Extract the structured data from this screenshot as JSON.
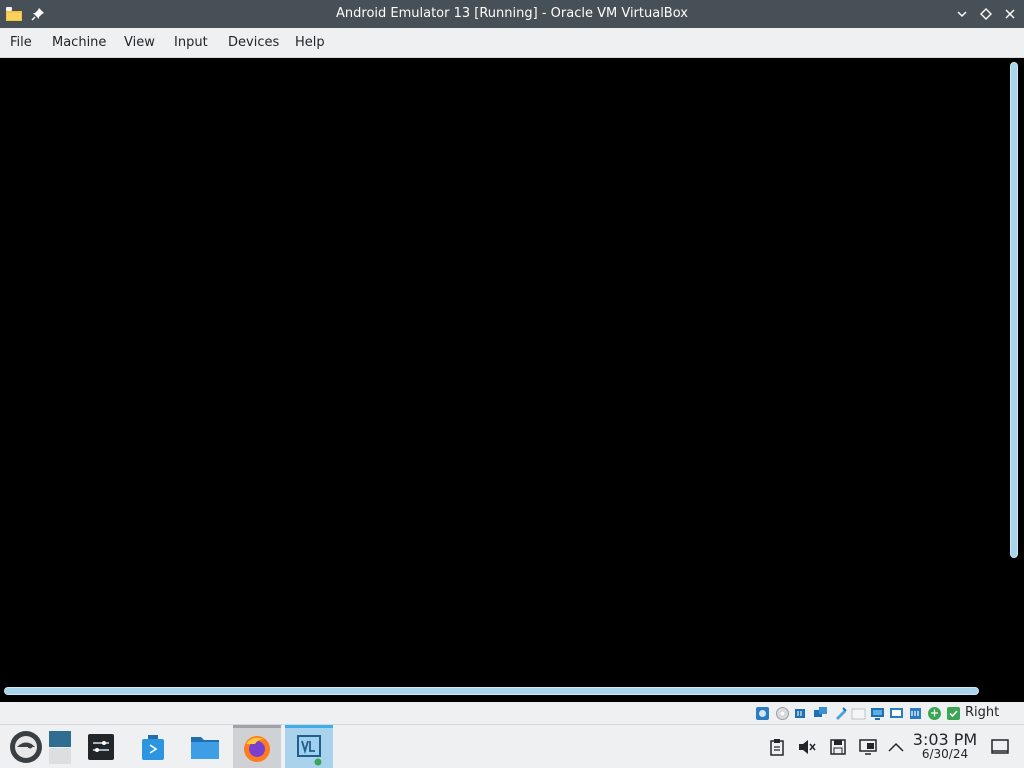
{
  "window": {
    "title": "Android Emulator 13 [Running] - Oracle VM VirtualBox",
    "app_icon": "virtualbox-folder-icon",
    "controls": [
      "minimize-icon",
      "maximize-icon",
      "close-icon"
    ]
  },
  "menubar": {
    "items": [
      "File",
      "Machine",
      "View",
      "Input",
      "Devices",
      "Help"
    ]
  },
  "statusbar": {
    "icons": [
      "hard-disk-icon",
      "optical-drive-icon",
      "audio-icon",
      "network-icon",
      "usb-icon",
      "shared-folders-icon",
      "display-icon",
      "recording-icon",
      "cpu-icon",
      "mouse-integration-icon",
      "keyboard-icon"
    ],
    "host_key": "Right Ctrl"
  },
  "taskbar": {
    "apps": [
      "opensuse-menu-icon",
      "pager-icon",
      "settings-icon",
      "discover-icon",
      "file-manager-icon",
      "firefox-icon",
      "virtualbox-icon"
    ],
    "tray": [
      "clipboard-icon",
      "volume-muted-icon",
      "save-icon",
      "network-icon",
      "show-hidden-icon"
    ],
    "clock": {
      "time": "3:03 PM",
      "date": "6/30/24"
    },
    "show_desktop": "show-desktop-icon"
  },
  "colors": {
    "titlebar": "#475057",
    "panel": "#eff0f1",
    "scrollbar": "#a8d4ec",
    "accent": "#3daee9"
  }
}
